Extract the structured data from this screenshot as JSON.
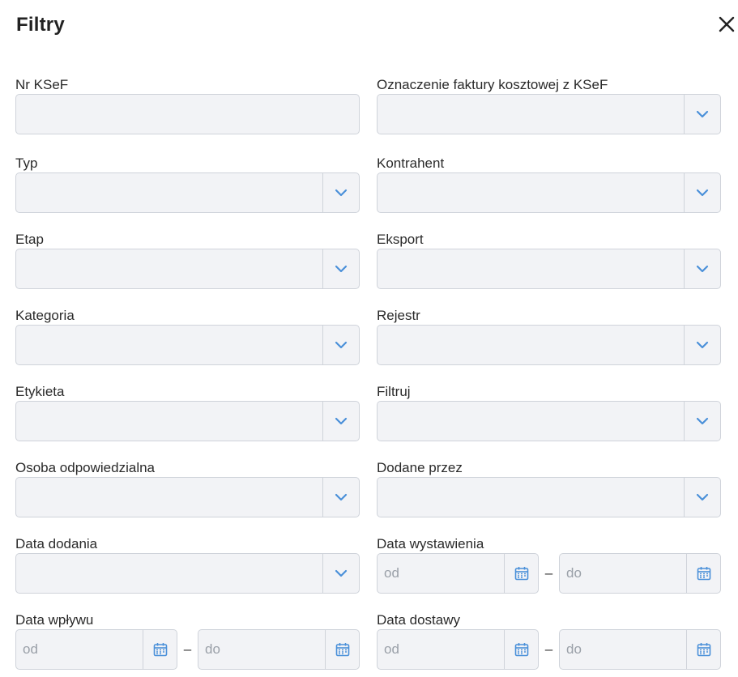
{
  "dialog": {
    "title": "Filtry",
    "fields": {
      "nr_ksef": {
        "label": "Nr KSeF",
        "value": ""
      },
      "oznaczenie": {
        "label": "Oznaczenie faktury kosztowej z KSeF",
        "value": ""
      },
      "typ": {
        "label": "Typ",
        "value": ""
      },
      "kontrahent": {
        "label": "Kontrahent",
        "value": ""
      },
      "etap": {
        "label": "Etap",
        "value": ""
      },
      "eksport": {
        "label": "Eksport",
        "value": ""
      },
      "kategoria": {
        "label": "Kategoria",
        "value": ""
      },
      "rejestr": {
        "label": "Rejestr",
        "value": ""
      },
      "etykieta": {
        "label": "Etykieta",
        "value": ""
      },
      "filtruj": {
        "label": "Filtruj",
        "value": ""
      },
      "osoba": {
        "label": "Osoba odpowiedzialna",
        "value": ""
      },
      "dodane_przez": {
        "label": "Dodane przez",
        "value": ""
      },
      "data_dodania": {
        "label": "Data dodania",
        "value": ""
      },
      "data_wystawienia": {
        "label": "Data wystawienia",
        "from_placeholder": "od",
        "to_placeholder": "do",
        "separator": "–"
      },
      "data_wplywu": {
        "label": "Data wpływu",
        "from_placeholder": "od",
        "to_placeholder": "do",
        "separator": "–"
      },
      "data_dostawy": {
        "label": "Data dostawy",
        "from_placeholder": "od",
        "to_placeholder": "do",
        "separator": "–"
      }
    }
  },
  "icons": {
    "close": "close-icon",
    "chevron": "chevron-down-icon",
    "calendar": "calendar-icon"
  },
  "colors": {
    "accent": "#4a90d9",
    "field_bg": "#f2f3f6",
    "field_border": "#cfd3da"
  }
}
